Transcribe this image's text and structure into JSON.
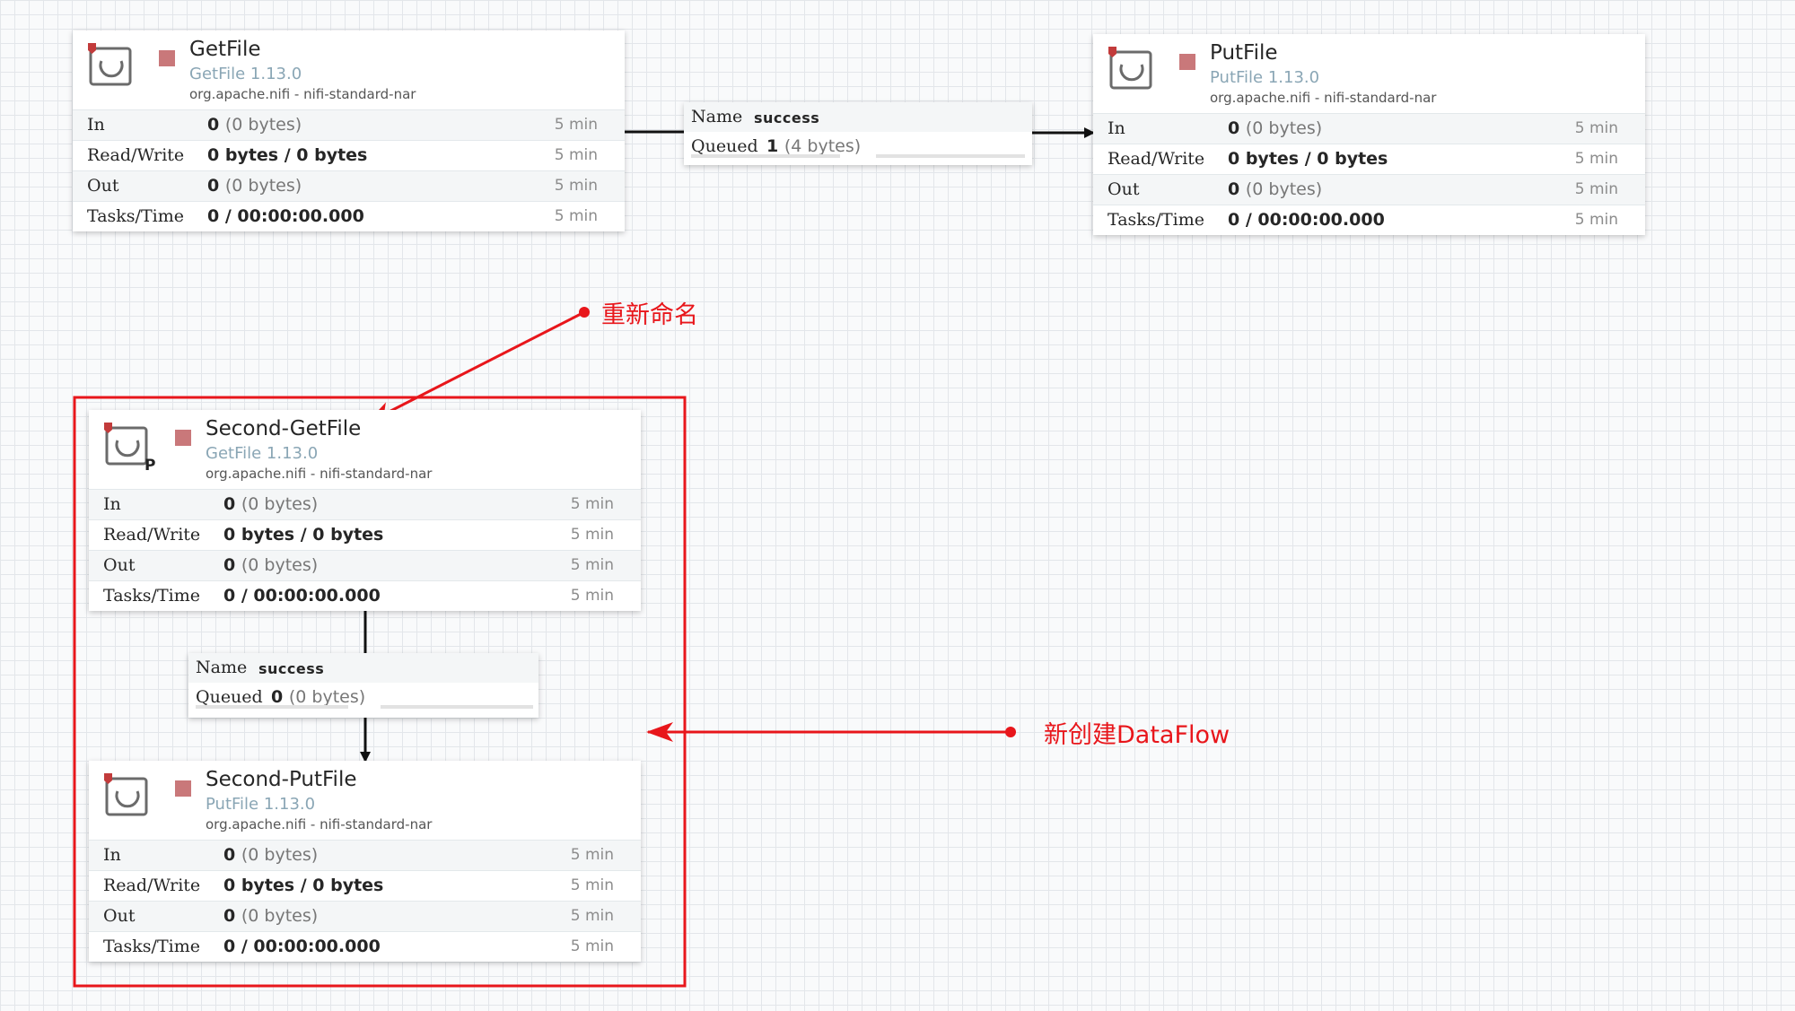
{
  "processors": {
    "getfile": {
      "name": "GetFile",
      "type": "GetFile 1.13.0",
      "bundle": "org.apache.nifi - nifi-standard-nar",
      "in": {
        "label": "In",
        "value": "0",
        "detail": "(0 bytes)",
        "time": "5 min"
      },
      "readwrite": {
        "label": "Read/Write",
        "value": "0 bytes / 0 bytes",
        "time": "5 min"
      },
      "out": {
        "label": "Out",
        "value": "0",
        "detail": "(0 bytes)",
        "time": "5 min"
      },
      "tasks": {
        "label": "Tasks/Time",
        "value": "0 / 00:00:00.000",
        "time": "5 min"
      }
    },
    "putfile": {
      "name": "PutFile",
      "type": "PutFile 1.13.0",
      "bundle": "org.apache.nifi - nifi-standard-nar",
      "in": {
        "label": "In",
        "value": "0",
        "detail": "(0 bytes)",
        "time": "5 min"
      },
      "readwrite": {
        "label": "Read/Write",
        "value": "0 bytes / 0 bytes",
        "time": "5 min"
      },
      "out": {
        "label": "Out",
        "value": "0",
        "detail": "(0 bytes)",
        "time": "5 min"
      },
      "tasks": {
        "label": "Tasks/Time",
        "value": "0 / 00:00:00.000",
        "time": "5 min"
      }
    },
    "second_getfile": {
      "name": "Second-GetFile",
      "type": "GetFile 1.13.0",
      "bundle": "org.apache.nifi - nifi-standard-nar",
      "badge": "P",
      "in": {
        "label": "In",
        "value": "0",
        "detail": "(0 bytes)",
        "time": "5 min"
      },
      "readwrite": {
        "label": "Read/Write",
        "value": "0 bytes / 0 bytes",
        "time": "5 min"
      },
      "out": {
        "label": "Out",
        "value": "0",
        "detail": "(0 bytes)",
        "time": "5 min"
      },
      "tasks": {
        "label": "Tasks/Time",
        "value": "0 / 00:00:00.000",
        "time": "5 min"
      }
    },
    "second_putfile": {
      "name": "Second-PutFile",
      "type": "PutFile 1.13.0",
      "bundle": "org.apache.nifi - nifi-standard-nar",
      "in": {
        "label": "In",
        "value": "0",
        "detail": "(0 bytes)",
        "time": "5 min"
      },
      "readwrite": {
        "label": "Read/Write",
        "value": "0 bytes / 0 bytes",
        "time": "5 min"
      },
      "out": {
        "label": "Out",
        "value": "0",
        "detail": "(0 bytes)",
        "time": "5 min"
      },
      "tasks": {
        "label": "Tasks/Time",
        "value": "0 / 00:00:00.000",
        "time": "5 min"
      }
    }
  },
  "connections": {
    "first": {
      "name_label": "Name",
      "name": "success",
      "queued_label": "Queued",
      "queued": "1",
      "queued_detail": "(4 bytes)"
    },
    "second": {
      "name_label": "Name",
      "name": "success",
      "queued_label": "Queued",
      "queued": "0",
      "queued_detail": "(0 bytes)"
    }
  },
  "annotations": {
    "rename": "重新命名",
    "new_dataflow": "新创建DataFlow",
    "color": "#e8161b"
  },
  "colors": {
    "status_stopped": "#c9787a",
    "type_text": "#8aa6b5",
    "canvas_grid": "#e3e6ea"
  },
  "icons": {
    "processor": "processor-icon",
    "stopped": "stopped-status-icon"
  }
}
